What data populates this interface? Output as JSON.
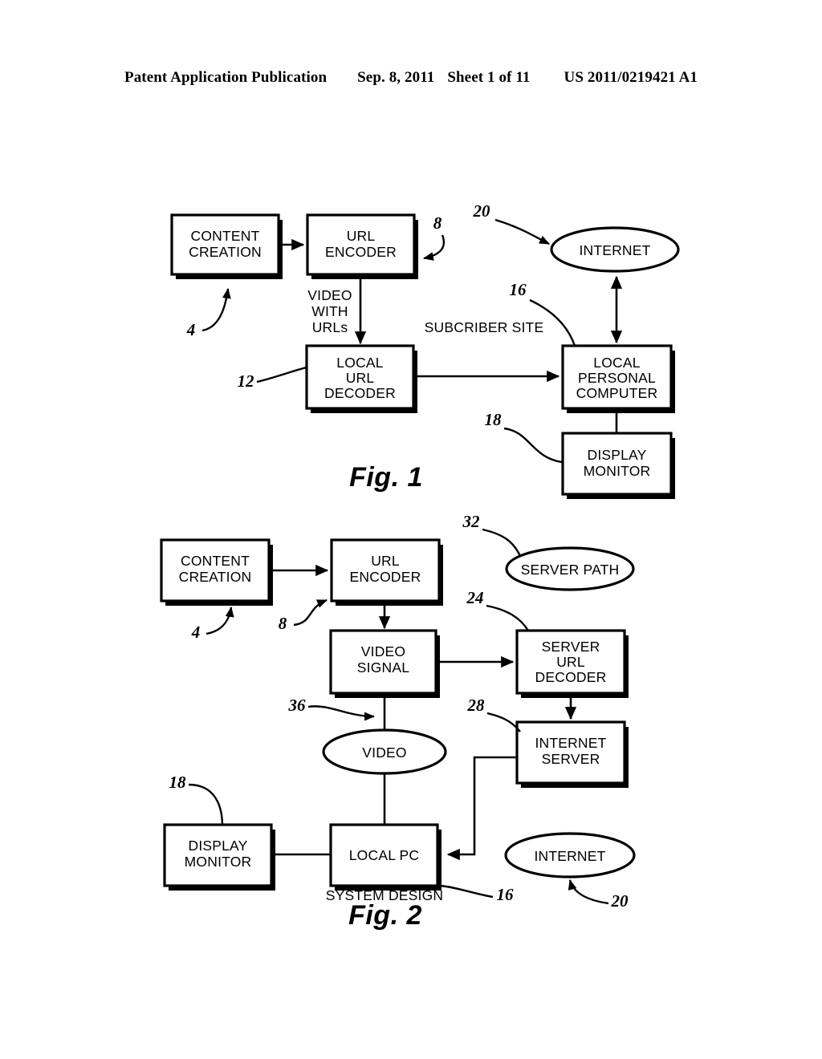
{
  "header": {
    "publication": "Patent Application Publication",
    "date": "Sep. 8, 2011",
    "sheet": "Sheet 1 of 11",
    "doc_number": "US 2011/0219421 A1"
  },
  "figures": [
    {
      "caption": "Fig. 1",
      "nodes": {
        "content_creation": "CONTENT\nCREATION",
        "content_creation_l1": "CONTENT",
        "content_creation_l2": "CREATION",
        "url_encoder_l1": "URL",
        "url_encoder_l2": "ENCODER",
        "internet": "INTERNET",
        "local_url_decoder_l1": "LOCAL",
        "local_url_decoder_l2": "URL",
        "local_url_decoder_l3": "DECODER",
        "local_pc_l1": "LOCAL",
        "local_pc_l2": "PERSONAL",
        "local_pc_l3": "COMPUTER",
        "display_monitor_l1": "DISPLAY",
        "display_monitor_l2": "MONITOR"
      },
      "edge_labels": {
        "video_with_urls_l1": "VIDEO",
        "video_with_urls_l2": "WITH",
        "video_with_urls_l3": "URLs",
        "subscriber_site": "SUBCRIBER SITE"
      },
      "ref_numbers": {
        "content_creation": "4",
        "url_encoder": "8",
        "local_url_decoder": "12",
        "local_personal_computer": "16",
        "display_monitor": "18",
        "internet": "20"
      }
    },
    {
      "caption": "Fig. 2",
      "nodes": {
        "content_creation_l1": "CONTENT",
        "content_creation_l2": "CREATION",
        "url_encoder_l1": "URL",
        "url_encoder_l2": "ENCODER",
        "server_path": "SERVER PATH",
        "video_signal_l1": "VIDEO",
        "video_signal_l2": "SIGNAL",
        "server_url_decoder_l1": "SERVER",
        "server_url_decoder_l2": "URL",
        "server_url_decoder_l3": "DECODER",
        "video": "VIDEO",
        "internet_server_l1": "INTERNET",
        "internet_server_l2": "SERVER",
        "display_monitor_l1": "DISPLAY",
        "display_monitor_l2": "MONITOR",
        "local_pc": "LOCAL PC",
        "internet": "INTERNET"
      },
      "edge_labels": {
        "system_design": "SYSTEM DESIGN"
      },
      "ref_numbers": {
        "content_creation": "4",
        "url_encoder": "8",
        "local_pc": "16",
        "display_monitor": "18",
        "internet": "20",
        "server_url_decoder": "24",
        "internet_server": "28",
        "server_path": "32",
        "video": "36"
      }
    }
  ],
  "colors": {
    "ink": "#000000",
    "paper": "#ffffff"
  }
}
